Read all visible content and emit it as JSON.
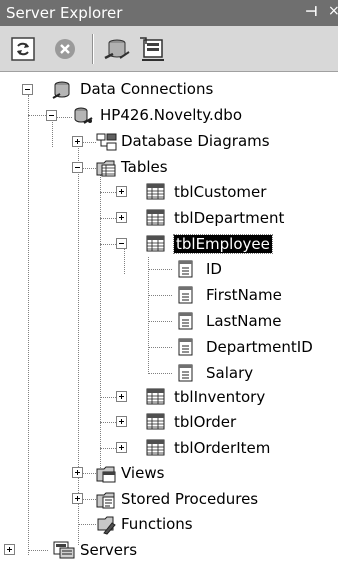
{
  "window": {
    "title": "Server Explorer",
    "pin_glyph": "⊣",
    "close_glyph": "×"
  },
  "toolbar": {
    "buttons": [
      {
        "name": "refresh-button",
        "icon": "refresh-icon"
      },
      {
        "name": "stop-button",
        "icon": "stop-icon"
      },
      {
        "name": "connect-to-database-button",
        "icon": "connect-database-icon"
      },
      {
        "name": "connect-to-server-button",
        "icon": "connect-server-icon"
      }
    ]
  },
  "tree": {
    "data_connections": "Data Connections",
    "connection": "HP426.Novelty.dbo",
    "database_diagrams": "Database Diagrams",
    "tables": "Tables",
    "tblCustomer": "tblCustomer",
    "tblDepartment": "tblDepartment",
    "tblEmployee": "tblEmployee",
    "columns": [
      "ID",
      "FirstName",
      "LastName",
      "DepartmentID",
      "Salary"
    ],
    "tblInventory": "tblInventory",
    "tblOrder": "tblOrder",
    "tblOrderItem": "tblOrderItem",
    "views": "Views",
    "stored_procedures": "Stored Procedures",
    "functions": "Functions",
    "servers": "Servers"
  },
  "colors": {
    "titlebar": "#6f6f6f",
    "toolbar": "#d8d8d8",
    "selection": "#000000"
  }
}
